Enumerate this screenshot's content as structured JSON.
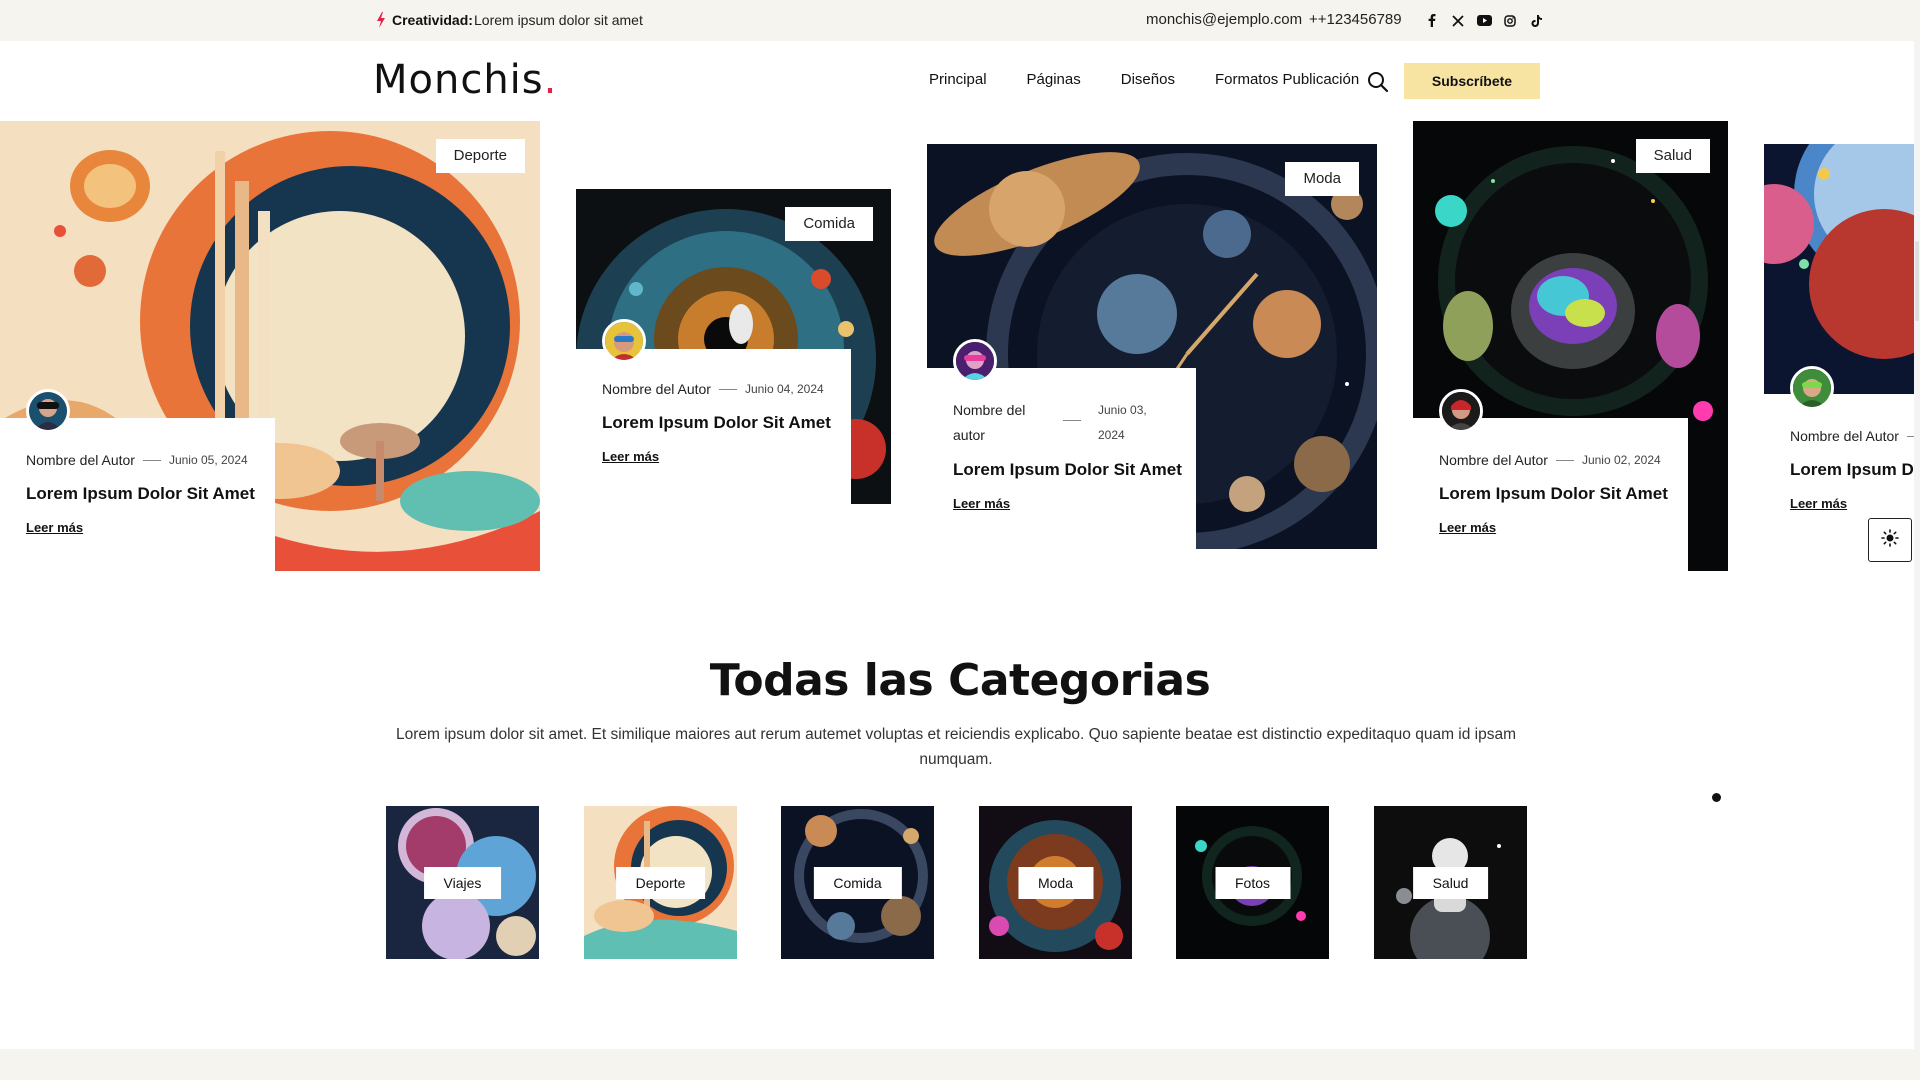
{
  "topbar": {
    "trend_label": "Creatividad:",
    "trend_text": "Lorem ipsum dolor sit amet",
    "email": "monchis@ejemplo.com",
    "phone": "++123456789",
    "socials": [
      "facebook-icon",
      "x-icon",
      "youtube-icon",
      "instagram-icon",
      "tiktok-icon"
    ]
  },
  "header": {
    "logo": "Monchis",
    "logo_dot": ".",
    "nav": [
      "Principal",
      "Páginas",
      "Diseños",
      "Formatos Publicación"
    ],
    "subscribe": "Subscríbete"
  },
  "cards": [
    {
      "tag": "Deporte",
      "author": "Nombre del Autor",
      "date": "Junio 05, 2024",
      "title": "Lorem Ipsum Dolor Sit Amet",
      "more": "Leer más"
    },
    {
      "tag": "Comida",
      "author": "Nombre del Autor",
      "date": "Junio 04, 2024",
      "title": "Lorem Ipsum Dolor Sit Amet",
      "more": "Leer más"
    },
    {
      "tag": "Moda",
      "author": "Nombre del autor",
      "date": "Junio 03, 2024",
      "title": "Lorem Ipsum Dolor Sit Amet",
      "more": "Leer más"
    },
    {
      "tag": "Salud",
      "author": "Nombre del Autor",
      "date": "Junio 02, 2024",
      "title": "Lorem Ipsum Dolor Sit Amet",
      "more": "Leer más"
    },
    {
      "author": "Nombre del Autor",
      "title": "Lorem Ipsum Do",
      "more": "Leer más"
    }
  ],
  "categories": {
    "heading": "Todas las Categorias",
    "description": "Lorem ipsum dolor sit amet. Et similique maiores aut rerum autemet voluptas et reiciendis explicabo. Quo sapiente beatae est distinctio expeditaquo quam id ipsam numquam.",
    "items": [
      "Viajes",
      "Deporte",
      "Comida",
      "Moda",
      "Fotos",
      "Salud"
    ]
  },
  "colors": {
    "topbar_bg": "#f6f4ee",
    "accent": "#e02447",
    "subscribe_bg": "#f7e3a2"
  }
}
